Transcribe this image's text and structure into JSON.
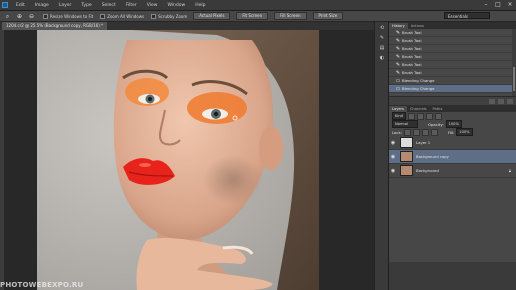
{
  "menubar": {
    "items": [
      "Edit",
      "Image",
      "Layer",
      "Type",
      "Select",
      "Filter",
      "View",
      "Window",
      "Help"
    ]
  },
  "options_bar": {
    "checkboxes": [
      "Resize Windows to Fit",
      "Zoom All Windows",
      "Scrubby Zoom"
    ],
    "buttons": [
      "Actual Pixels",
      "Fit Screen",
      "Fill Screen",
      "Print Size"
    ],
    "workspace": "Essentials"
  },
  "document_tab": {
    "label": "1204.cr2 @ 25.5% (Background copy, RGB/16) *"
  },
  "watermark": "PHOTOWEBEXPO.RU",
  "history": {
    "tabs": [
      "History",
      "Actions"
    ],
    "items": [
      "Brush Tool",
      "Brush Tool",
      "Brush Tool",
      "Brush Tool",
      "Brush Tool",
      "Brush Tool",
      "Blending Change",
      "Blending Change"
    ],
    "selected_index": 7
  },
  "layers": {
    "tabs": [
      "Layers",
      "Channels",
      "Paths"
    ],
    "kind_label": "Kind",
    "blend_mode": "Normal",
    "opacity_label": "Opacity:",
    "opacity_value": "100%",
    "lock_label": "Lock:",
    "fill_label": "Fill:",
    "fill_value": "100%",
    "list": [
      {
        "name": "Layer 1",
        "italic": false,
        "selected": false
      },
      {
        "name": "Background copy",
        "italic": false,
        "selected": true
      },
      {
        "name": "Background",
        "italic": true,
        "selected": false
      }
    ]
  }
}
